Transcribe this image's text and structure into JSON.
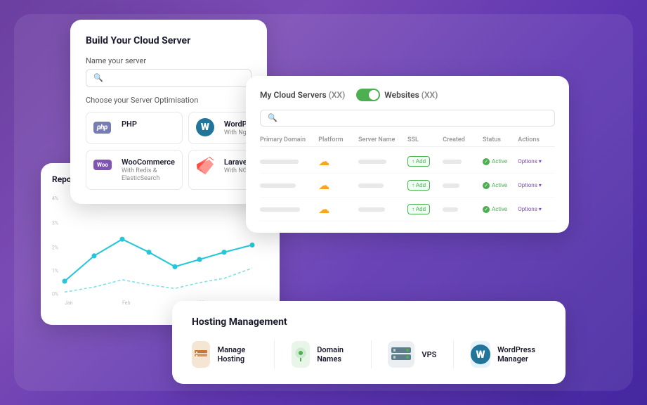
{
  "background": "#7b4bb5",
  "build_card": {
    "title": "Build Your Cloud Server",
    "name_label": "Name your server",
    "name_placeholder": "🔍",
    "optimisation_label": "Choose your Server Optimisation",
    "options": [
      {
        "id": "php",
        "name": "PHP",
        "sub": "",
        "logo_type": "php"
      },
      {
        "id": "wordpress",
        "name": "WordPress",
        "sub": "With Nginx",
        "logo_type": "wp"
      },
      {
        "id": "woocommerce",
        "name": "WooCommerce",
        "sub": "With Redis & ElasticSearch",
        "logo_type": "woo"
      },
      {
        "id": "laravel",
        "name": "Laravel",
        "sub": "With NGINX",
        "logo_type": "laravel"
      }
    ]
  },
  "servers_card": {
    "title": "My Cloud Servers",
    "count": "(XX)",
    "toggle_active": true,
    "websites_label": "Websites",
    "websites_count": "(XX)",
    "search_placeholder": "🔍",
    "columns": [
      "Primary Domain",
      "Platform",
      "Server Name",
      "SSL",
      "Created",
      "Status",
      "Actions"
    ],
    "rows": [
      {
        "ssl": "Add",
        "status": "Active",
        "action": "Options"
      },
      {
        "ssl": "Add",
        "status": "Active",
        "action": "Options"
      },
      {
        "ssl": "Add",
        "status": "Active",
        "action": "Options"
      }
    ]
  },
  "reports_card": {
    "title": "Reports",
    "y_labels": [
      "4%",
      "3%",
      "2%",
      "1%",
      "0%"
    ],
    "x_labels": [
      "Jan",
      "Feb",
      "Mar"
    ]
  },
  "hosting_card": {
    "title": "Hosting Management",
    "items": [
      {
        "id": "manage-hosting",
        "label": "Manage Hosting",
        "icon": "🧰",
        "bg": "#c8763a"
      },
      {
        "id": "domain-names",
        "label": "Domain Names",
        "icon": "📍",
        "bg": "#4CAF50"
      },
      {
        "id": "vps",
        "label": "VPS",
        "icon": "🖥️",
        "bg": "#607D8B"
      },
      {
        "id": "wordpress-manager",
        "label": "WordPress Manager",
        "icon": "🔷",
        "bg": "#21759b"
      }
    ]
  }
}
